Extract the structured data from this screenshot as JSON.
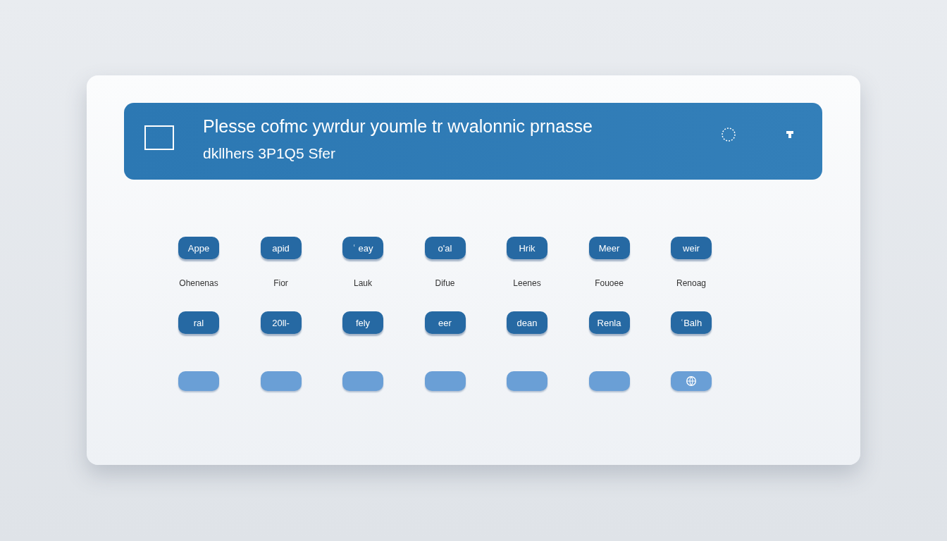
{
  "banner": {
    "title": "Plesse cofmc ywrdur youmle tr wvalonnic prnasse",
    "subtitle": "dkllhers  3P1Q5 Sfer"
  },
  "rows": [
    {
      "buttons": [
        {
          "label": "Appe",
          "caption": "Ohenenas",
          "disabled": false
        },
        {
          "label": "apid",
          "caption": "Fior",
          "disabled": false
        },
        {
          "label": "ʿ eay",
          "caption": "Lauk",
          "disabled": false
        },
        {
          "label": "o'al",
          "caption": "Difue",
          "disabled": false
        },
        {
          "label": "Hrik",
          "caption": "Leenes",
          "disabled": false
        },
        {
          "label": "Meer",
          "caption": "Fouoee",
          "disabled": false
        },
        {
          "label": "weir",
          "caption": "Renoag",
          "disabled": false
        }
      ]
    },
    {
      "buttons": [
        {
          "label": "ral",
          "disabled": false
        },
        {
          "label": "20ll‑",
          "disabled": false
        },
        {
          "label": "fely",
          "disabled": false
        },
        {
          "label": "eer",
          "disabled": false
        },
        {
          "label": "dean",
          "disabled": false
        },
        {
          "label": "Renla",
          "disabled": false
        },
        {
          "label": "ʿBalh",
          "disabled": false
        }
      ]
    },
    {
      "buttons": [
        {
          "disabled": true
        },
        {
          "disabled": true
        },
        {
          "disabled": true
        },
        {
          "disabled": true
        },
        {
          "disabled": true
        },
        {
          "disabled": true
        },
        {
          "disabled": true,
          "kind": "icon"
        }
      ]
    }
  ]
}
